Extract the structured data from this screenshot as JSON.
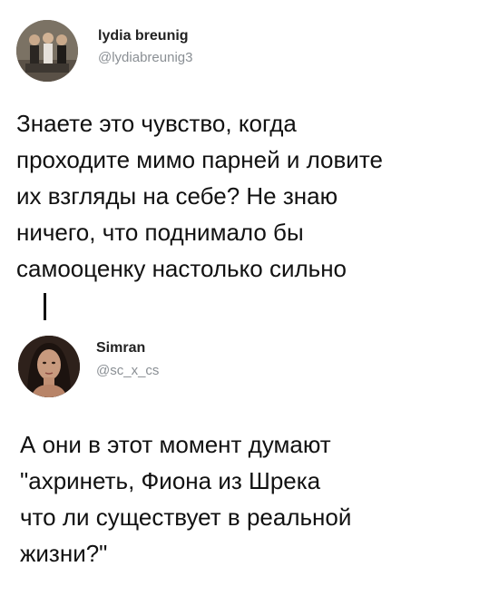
{
  "tweets": [
    {
      "name": "lydia breunig",
      "handle": "@lydiabreunig3",
      "text": "Знаете это чувство, когда\nпроходите мимо парней и ловите\nих взгляды на себе? Не знаю\nничего, что поднимало бы\nсамооценку настолько сильно"
    },
    {
      "name": "Simran",
      "handle": "@sc_x_cs",
      "text": "А они в этот момент думают\n\"ахринеть, Фиона из Шрека\nчто ли существует в реальной\nжизни?\""
    }
  ]
}
